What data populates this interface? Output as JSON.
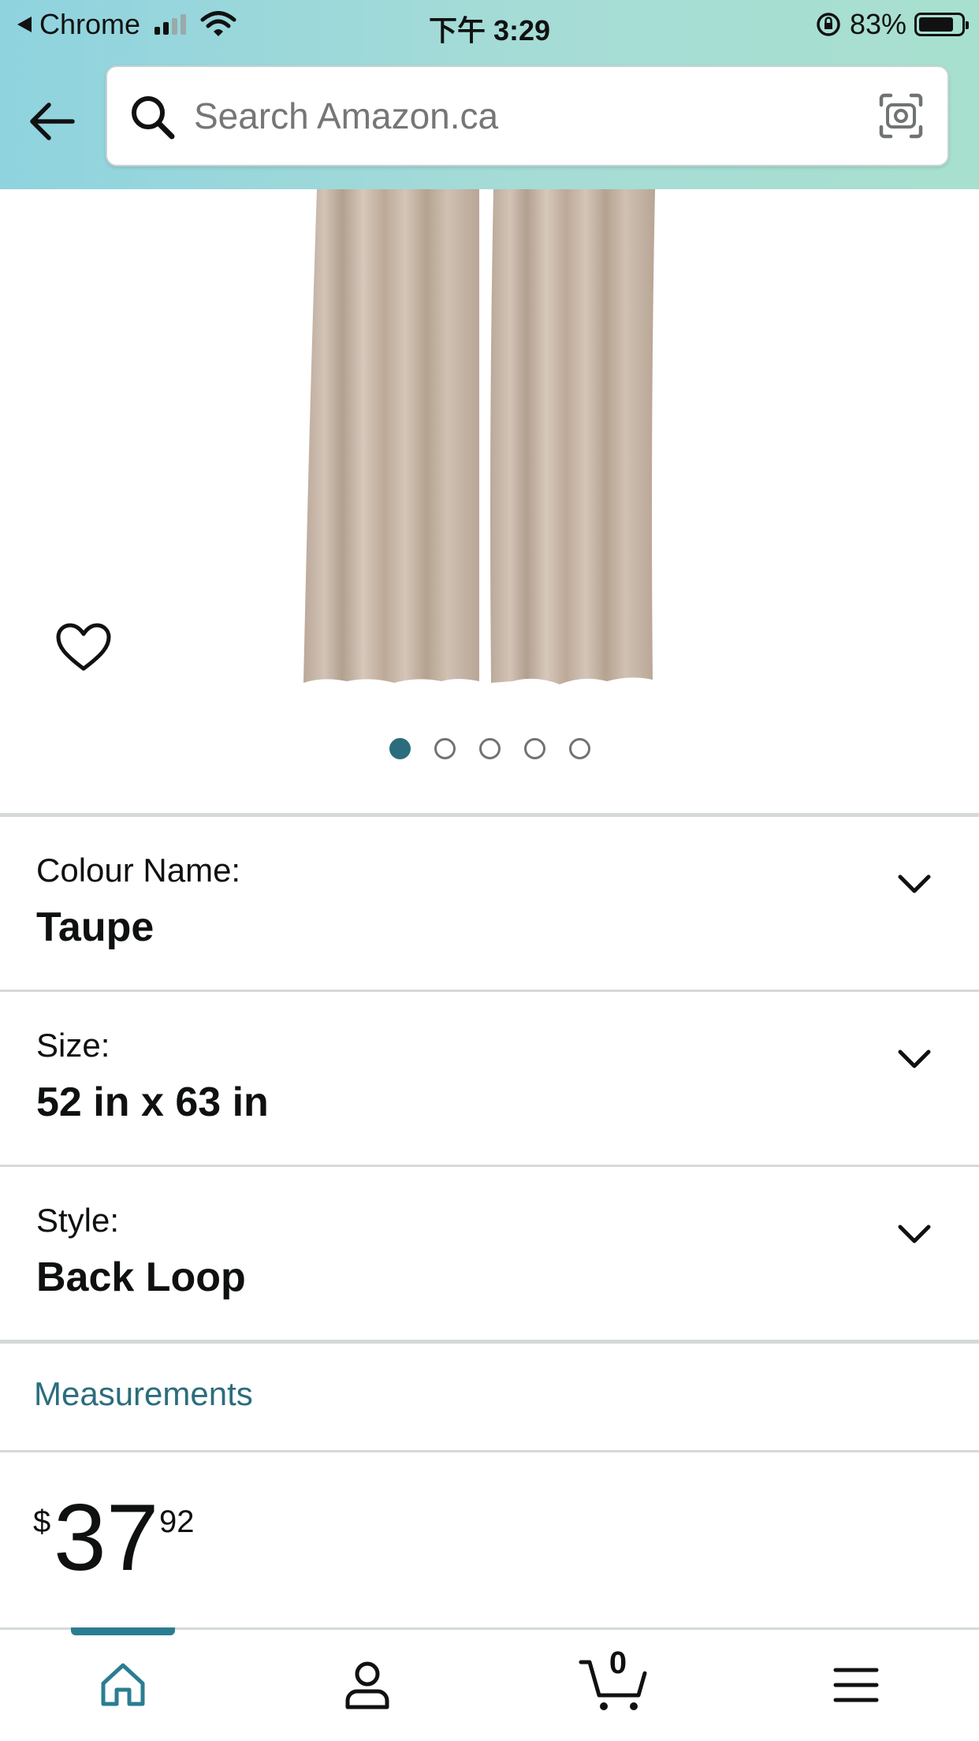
{
  "status_bar": {
    "back_app": "Chrome",
    "time": "下午 3:29",
    "battery": "83%",
    "battery_level": 0.83
  },
  "search": {
    "placeholder": "Search Amazon.ca"
  },
  "product": {
    "image_alt": "Taupe curtain panels",
    "image_count": 5,
    "active_image": 1,
    "colors": {
      "curtain": "#c9b7a9",
      "accent": "#2b6d7d"
    }
  },
  "variations": [
    {
      "label": "Colour Name:",
      "value": "Taupe"
    },
    {
      "label": "Size:",
      "value": "52 in x 63 in"
    },
    {
      "label": "Style:",
      "value": "Back Loop"
    }
  ],
  "measurements_link": "Measurements",
  "price": {
    "symbol": "$",
    "whole": "37",
    "fraction": "92"
  },
  "bottom_nav": {
    "items": [
      "home-icon",
      "account-icon",
      "cart-icon",
      "menu-icon"
    ],
    "cart_count": "0",
    "active": "home"
  }
}
